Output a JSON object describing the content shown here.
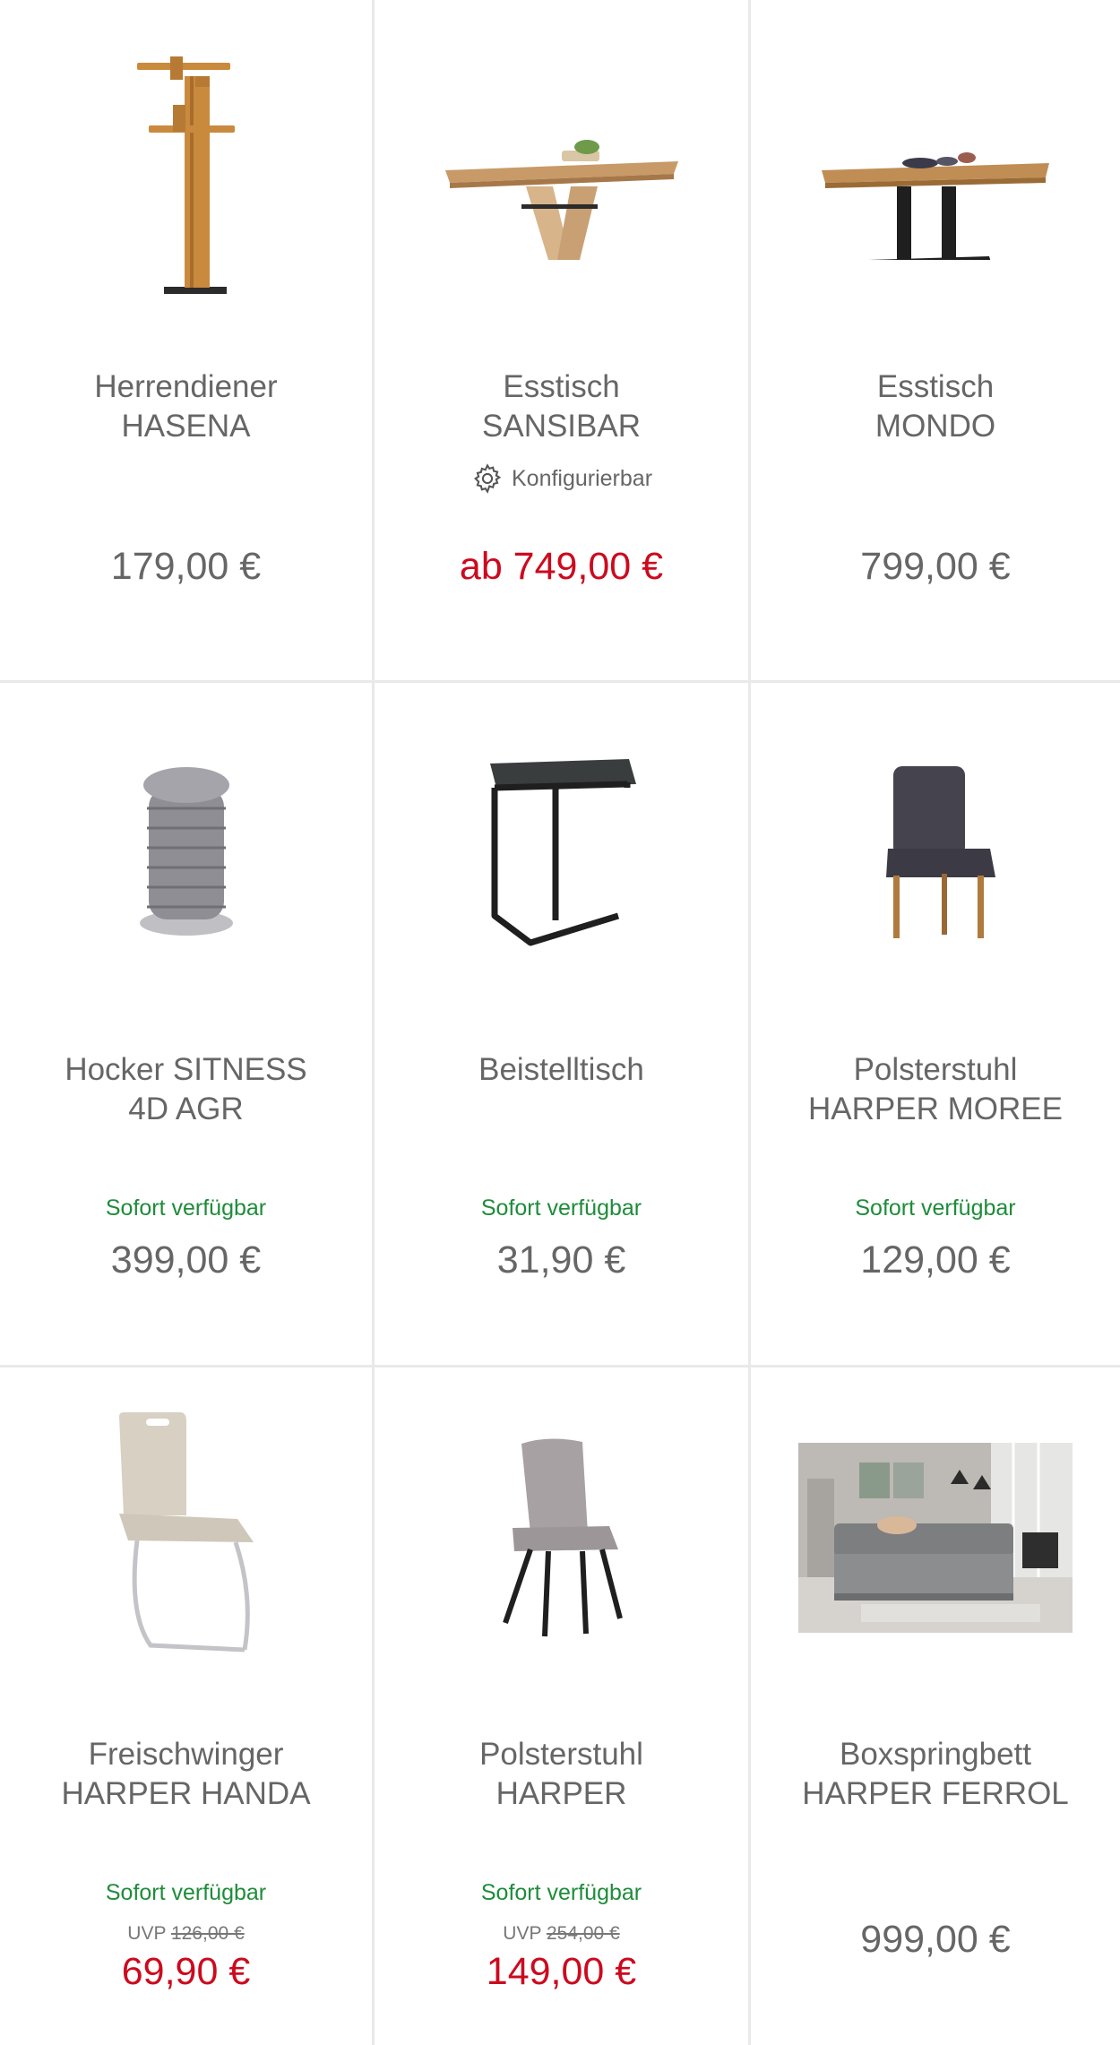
{
  "products": [
    {
      "title_line1": "Herrendiener",
      "title_line2": "HASENA",
      "price": "179,00 €",
      "image": "valet-stand"
    },
    {
      "title_line1": "Esstisch",
      "title_line2": "SANSIBAR",
      "configurable_label": "Konfigurierbar",
      "configurable_icon": "gear-icon",
      "price": "ab 749,00 €",
      "price_color": "#cc0a1e",
      "image": "dining-table-v-base"
    },
    {
      "title_line1": "Esstisch",
      "title_line2": "MONDO",
      "price": "799,00 €",
      "image": "dining-table-black-base"
    },
    {
      "title_line1": "Hocker SITNESS",
      "title_line2": "4D AGR",
      "stock": "Sofort verfügbar",
      "price": "399,00 €",
      "image": "stool-grey"
    },
    {
      "title_line1": "Beistelltisch",
      "title_line2": "",
      "stock": "Sofort verfügbar",
      "price": "31,90 €",
      "image": "side-table-black"
    },
    {
      "title_line1": "Polsterstuhl",
      "title_line2": "HARPER MOREE",
      "stock": "Sofort verfügbar",
      "price": "129,00 €",
      "image": "upholstered-chair-anthracite"
    },
    {
      "title_line1": "Freischwinger",
      "title_line2": "HARPER HANDA",
      "stock": "Sofort verfügbar",
      "uvp_label": "UVP",
      "uvp_price": "126,00 €",
      "price": "69,90 €",
      "price_color": "#cc0a1e",
      "image": "cantilever-chair-beige"
    },
    {
      "title_line1": "Polsterstuhl",
      "title_line2": "HARPER",
      "stock": "Sofort verfügbar",
      "uvp_label": "UVP",
      "uvp_price": "254,00 €",
      "price": "149,00 €",
      "price_color": "#cc0a1e",
      "image": "upholstered-chair-grey"
    },
    {
      "title_line1": "Boxspringbett",
      "title_line2": "HARPER FERROL",
      "price": "999,00 €",
      "image": "boxspring-bed-photo"
    }
  ],
  "colors": {
    "stock_green": "#1e8c3a",
    "sale_red": "#cc0a1e",
    "text_grey": "#666666",
    "divider": "#e9e9e9"
  }
}
